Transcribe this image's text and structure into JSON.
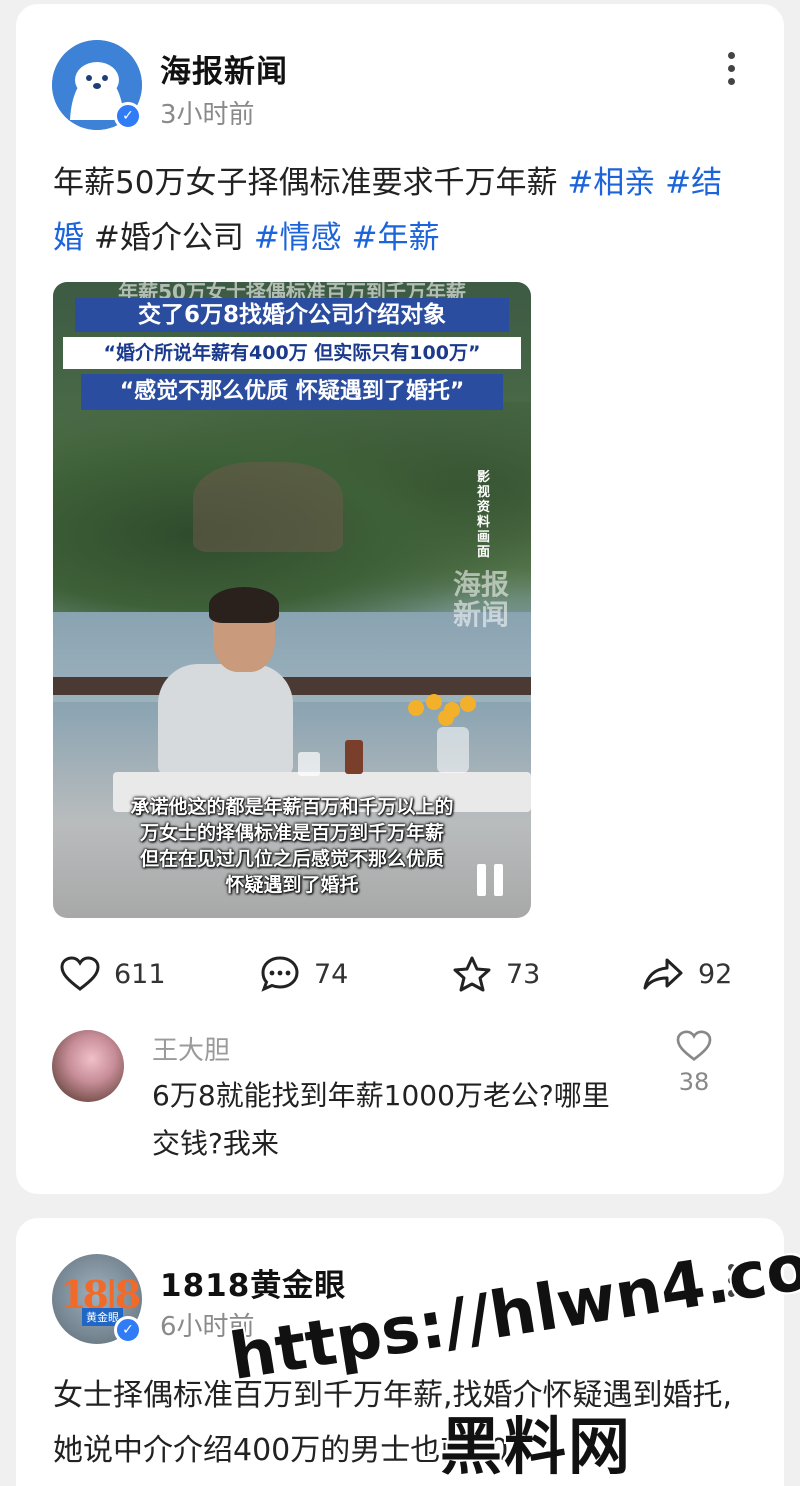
{
  "colors": {
    "tag": "#1c64d9",
    "verify": "#2f7cf6",
    "background": "#f0f0f0"
  },
  "posts": [
    {
      "author": "海报新闻",
      "time": "3小时前",
      "text_prefix": "年薪50万女子择偶标准要求千万年薪 ",
      "tags": [
        "#相亲",
        "#结婚",
        "#婚介公司",
        "#情感",
        "#年薪"
      ],
      "video": {
        "overlay_top": "年薪50万女士择偶标准百万到千万年薪",
        "overlay_1": "交了6万8找婚介公司介绍对象",
        "overlay_2": "“婚介所说年薪有400万 但实际只有100万”",
        "overlay_3": "“感觉不那么优质 怀疑遇到了婚托”",
        "side_label": "影视资料画面",
        "watermark": "海报新闻",
        "subtitles": [
          "承诺他这的都是年薪百万和千万以上的",
          "万女士的择偶标准是百万到千万年薪",
          "但在在见过几位之后感觉不那么优质",
          "怀疑遇到了婚托"
        ],
        "pause_icon": "pause-icon"
      },
      "actions": {
        "likes": "611",
        "comments": "74",
        "favorites": "73",
        "shares": "92"
      },
      "top_comment": {
        "user": "王大胆",
        "text": "6万8就能找到年薪1000万老公?哪里交钱?我来",
        "likes": "38"
      }
    },
    {
      "author": "1818黄金眼",
      "time": "6小时前",
      "avatar_logo": "18|8",
      "avatar_badge": "黄金眼",
      "text": "女士择偶标准百万到千万年薪,找婚介怀疑遇到婚托,她说中介介绍400万的男士也就100"
    }
  ],
  "overlay_watermark": {
    "url": "https://hlwn4.com",
    "site": "黑料网"
  }
}
